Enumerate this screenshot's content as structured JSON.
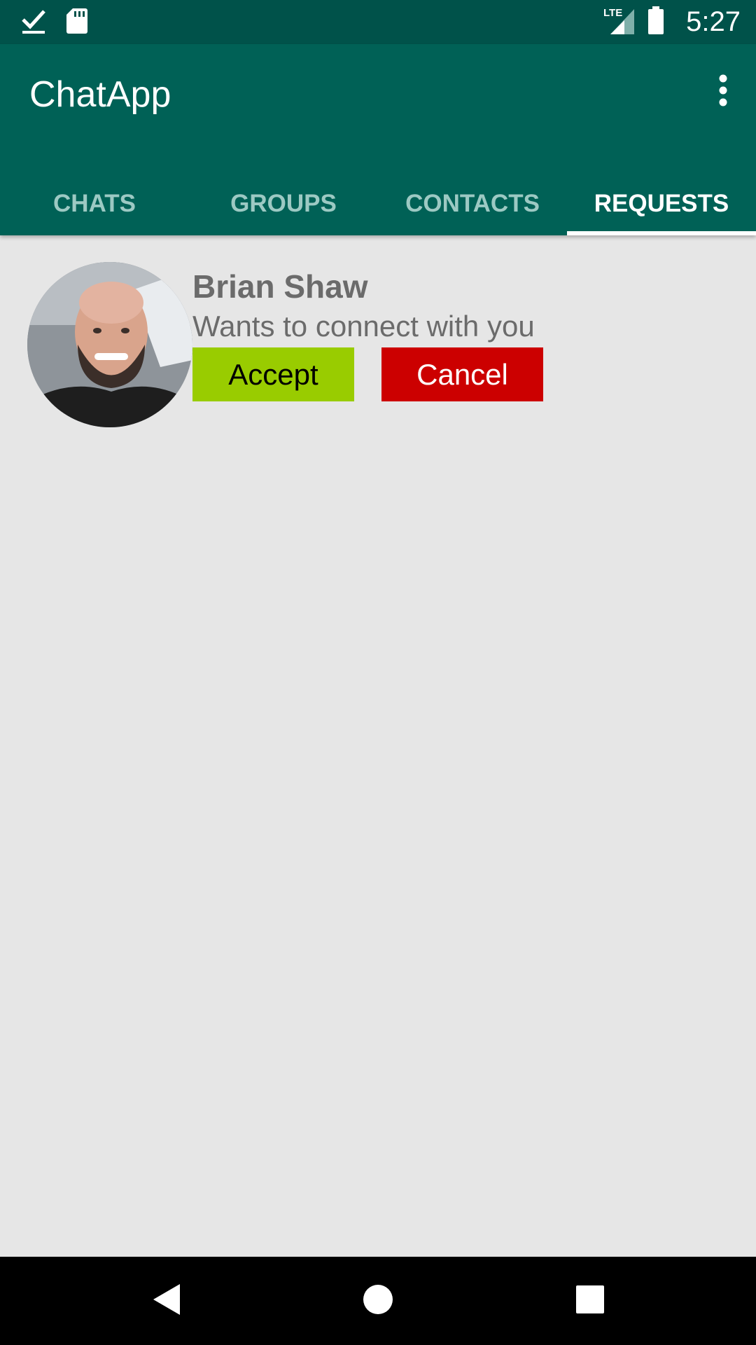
{
  "status_bar": {
    "time": "5:27",
    "network": "LTE",
    "icons": [
      "download-done-icon",
      "sd-card-icon",
      "lte-signal-icon",
      "battery-icon"
    ]
  },
  "app_bar": {
    "title": "ChatApp",
    "menu_icon": "more-vert-icon"
  },
  "tabs": [
    {
      "label": "CHATS",
      "active": false
    },
    {
      "label": "GROUPS",
      "active": false
    },
    {
      "label": "CONTACTS",
      "active": false
    },
    {
      "label": "REQUESTS",
      "active": true
    }
  ],
  "requests": [
    {
      "name": "Brian Shaw",
      "status": "Wants to connect with you",
      "accept_label": "Accept",
      "cancel_label": "Cancel"
    }
  ],
  "navigation": {
    "icons": [
      "back-icon",
      "home-icon",
      "recents-icon"
    ]
  },
  "colors": {
    "status_bar": "#00524a",
    "app_bar": "#006156",
    "background": "#e6e6e6",
    "accept": "#99cc00",
    "cancel": "#cc0000",
    "tab_inactive": "#9cc9c3"
  }
}
